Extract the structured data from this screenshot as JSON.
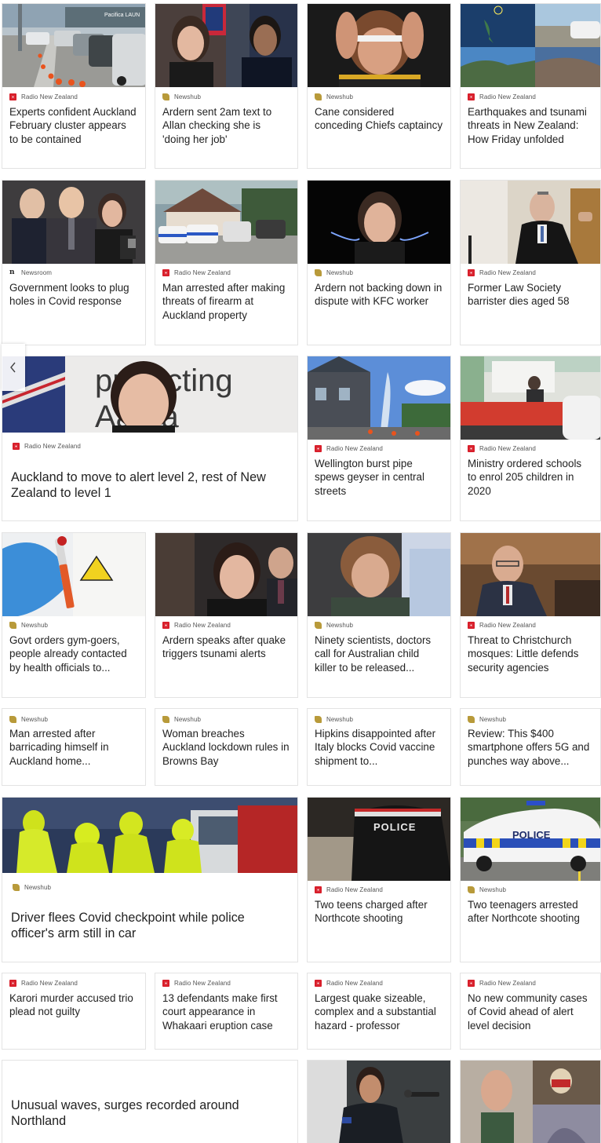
{
  "sources": {
    "rnz": "Radio New Zealand",
    "newshub": "Newshub",
    "newsroom": "Newsroom"
  },
  "articles": [
    {
      "source": "Radio New Zealand",
      "title": "Experts confident Auckland February cluster appears to be contained"
    },
    {
      "source": "Newshub",
      "title": "Ardern sent 2am text to Allan checking she is 'doing her job'"
    },
    {
      "source": "Newshub",
      "title": "Cane considered conceding Chiefs captaincy"
    },
    {
      "source": "Radio New Zealand",
      "title": "Earthquakes and tsunami threats in New Zealand: How Friday unfolded"
    },
    {
      "source": "Newsroom",
      "title": "Government looks to plug holes in Covid response"
    },
    {
      "source": "Radio New Zealand",
      "title": "Man arrested after making threats of firearm at Auckland property"
    },
    {
      "source": "Newshub",
      "title": "Ardern not backing down in dispute with KFC worker"
    },
    {
      "source": "Radio New Zealand",
      "title": "Former Law Society barrister dies aged 58"
    },
    {
      "source": "Radio New Zealand",
      "title": "Auckland to move to alert level 2, rest of New Zealand to level 1"
    },
    {
      "source": "Radio New Zealand",
      "title": "Wellington burst pipe spews geyser in central streets"
    },
    {
      "source": "Radio New Zealand",
      "title": "Ministry ordered schools to enrol 205 children in 2020"
    },
    {
      "source": "Newshub",
      "title": "Govt orders gym-goers, people already contacted by health officials to..."
    },
    {
      "source": "Radio New Zealand",
      "title": "Ardern speaks after quake triggers tsunami alerts"
    },
    {
      "source": "Newshub",
      "title": "Ninety scientists, doctors call for Australian child killer to be released..."
    },
    {
      "source": "Radio New Zealand",
      "title": "Threat to Christchurch mosques: Little defends security agencies"
    },
    {
      "source": "Newshub",
      "title": "Man arrested after barricading himself in Auckland home..."
    },
    {
      "source": "Newshub",
      "title": "Woman breaches Auckland lockdown rules in Browns Bay"
    },
    {
      "source": "Newshub",
      "title": "Hipkins disappointed after Italy blocks Covid vaccine shipment to..."
    },
    {
      "source": "Newshub",
      "title": "Review: This $400 smartphone offers 5G and punches way above..."
    },
    {
      "source": "Newshub",
      "title": "Driver flees Covid checkpoint while police officer's arm still in car"
    },
    {
      "source": "Radio New Zealand",
      "title": "Two teens charged after Northcote shooting"
    },
    {
      "source": "Newshub",
      "title": "Two teenagers arrested after Northcote shooting"
    },
    {
      "source": "Radio New Zealand",
      "title": "Karori murder accused trio plead not guilty"
    },
    {
      "source": "Radio New Zealand",
      "title": "13 defendants make first court appearance in Whakaari eruption case"
    },
    {
      "source": "Radio New Zealand",
      "title": "Largest quake sizeable, complex and a substantial hazard - professor"
    },
    {
      "source": "Radio New Zealand",
      "title": "No new community cases of Covid ahead of alert level decision"
    },
    {
      "source": "",
      "title": "Unusual waves, surges recorded around Northland"
    }
  ],
  "image_text": {
    "protecting": "protecting",
    "aotearoa": "Aaroa",
    "police_vest": "POLICE",
    "police_car": "POLICE",
    "pacifica": "Pacifica LAUN"
  },
  "colors": {
    "rnz": "#d81e2a",
    "newshub": "#b89a3a",
    "border": "#e3e3e3"
  }
}
